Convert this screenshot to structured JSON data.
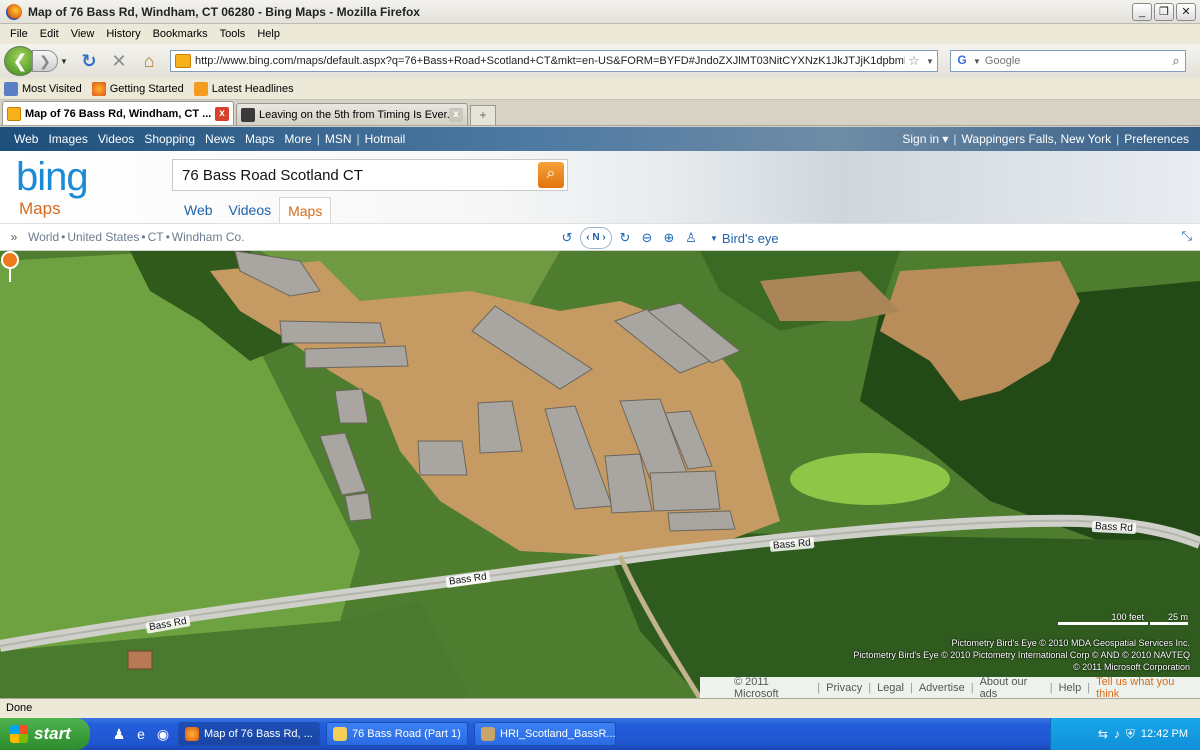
{
  "window": {
    "title": "Map of 76 Bass Rd, Windham, CT 06280 - Bing Maps - Mozilla Firefox",
    "min_label": "_",
    "max_label": "❐",
    "close_label": "✕"
  },
  "menu": [
    "File",
    "Edit",
    "View",
    "History",
    "Bookmarks",
    "Tools",
    "Help"
  ],
  "nav": {
    "back_label": "❮",
    "forward_label": "❯",
    "url": "http://www.bing.com/maps/default.aspx?q=76+Bass+Road+Scotland+CT&mkt=en-US&FORM=BYFD#JndoZXJlMT03NitCYXNzK1JkJTJjK1dpbmRoYW0lMmMr",
    "search_placeholder": "Google"
  },
  "bookmarks": [
    "Most Visited",
    "Getting Started",
    "Latest Headlines"
  ],
  "tabs": [
    {
      "label": "Map of 76 Bass Rd, Windham, CT ...",
      "active": true
    },
    {
      "label": "Leaving on the 5th from Timing Is Ever...",
      "active": false
    }
  ],
  "bing": {
    "topnav_left": [
      "Web",
      "Images",
      "Videos",
      "Shopping",
      "News",
      "Maps",
      "More"
    ],
    "topnav_msn": "MSN",
    "topnav_hotmail": "Hotmail",
    "sign_in": "Sign in ▾",
    "location": "Wappingers Falls, New York",
    "preferences": "Preferences",
    "logo": "bing",
    "maps_label": "Maps",
    "query": "76 Bass Road Scotland CT",
    "scopes": [
      "Web",
      "Videos",
      "Maps"
    ]
  },
  "map_toolbar": {
    "breadcrumb": [
      "World",
      "United States",
      "CT",
      "Windham Co."
    ],
    "compass_label": "N",
    "view_mode": "Bird's eye"
  },
  "map": {
    "road_label": "Bass Rd",
    "scale_left": "100 feet",
    "scale_right": "25 m",
    "attribution": [
      "Pictometry Bird's Eye © 2010 MDA Geospatial Services Inc.",
      "Pictometry Bird's Eye © 2010 Pictometry International Corp  © AND  © 2010 NAVTEQ",
      "© 2011 Microsoft Corporation"
    ]
  },
  "footer": {
    "copyright": "© 2011 Microsoft",
    "links": [
      "Privacy",
      "Legal",
      "Advertise",
      "About our ads",
      "Help"
    ],
    "tell": "Tell us what you think"
  },
  "status": "Done",
  "taskbar": {
    "start": "start",
    "tasks": [
      "Map of 76 Bass Rd, ...",
      "76 Bass Road (Part 1)",
      "HRI_Scotland_BassR..."
    ],
    "clock": "12:42 PM"
  },
  "colors": {
    "bing_orange": "#d36b1c",
    "bing_blue": "#1b8bd6",
    "xp_blue": "#245edb"
  }
}
